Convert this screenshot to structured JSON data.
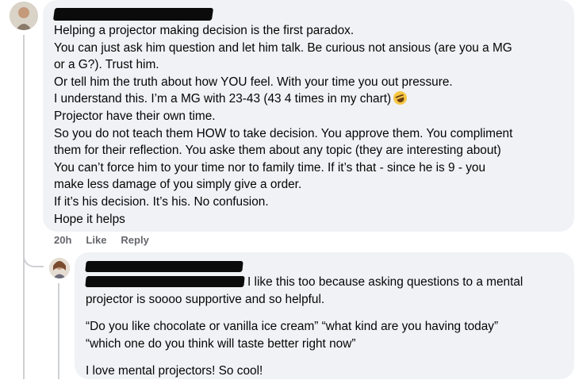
{
  "main_comment": {
    "lines": [
      "Helping a projector making decision is the first paradox.",
      "You can just ask him question and let him talk. Be curious not ansious (are you a MG",
      "or a G?). Trust him.",
      "Or tell him the truth about how YOU feel. With your time you out pressure.",
      "I understand this. I’m a MG with 23-43 (43 4 times in my chart)",
      "Projector have their own time.",
      "So you do not teach them HOW to take decision. You approve them. You compliment",
      "them for their reflection. You aske them about any topic (they are interesting about)",
      "You can’t force him to your time nor to family time. If it’s that - since he is 9 - you",
      "make less damage of you simply give a order.",
      "If it’s his decision. It’s his. No confusion.",
      "Hope it helps"
    ],
    "emoji": "rolling-on-floor-laughing-emoji",
    "actions": {
      "time": "20h",
      "like": "Like",
      "reply": "Reply"
    }
  },
  "reply_comment": {
    "first_line_text": "I like this too because asking questions to a mental",
    "lines": [
      "projector is soooo supportive and so helpful.",
      "“Do you like chocolate or vanilla ice cream” “what kind are you having today”",
      "“which one do you think will taste better right now”",
      "I love mental projectors! So cool!"
    ]
  },
  "colors": {
    "bubble": "#f0f2f5",
    "text": "#050505",
    "secondary": "#65676b",
    "thread_line": "#ced0d4"
  }
}
